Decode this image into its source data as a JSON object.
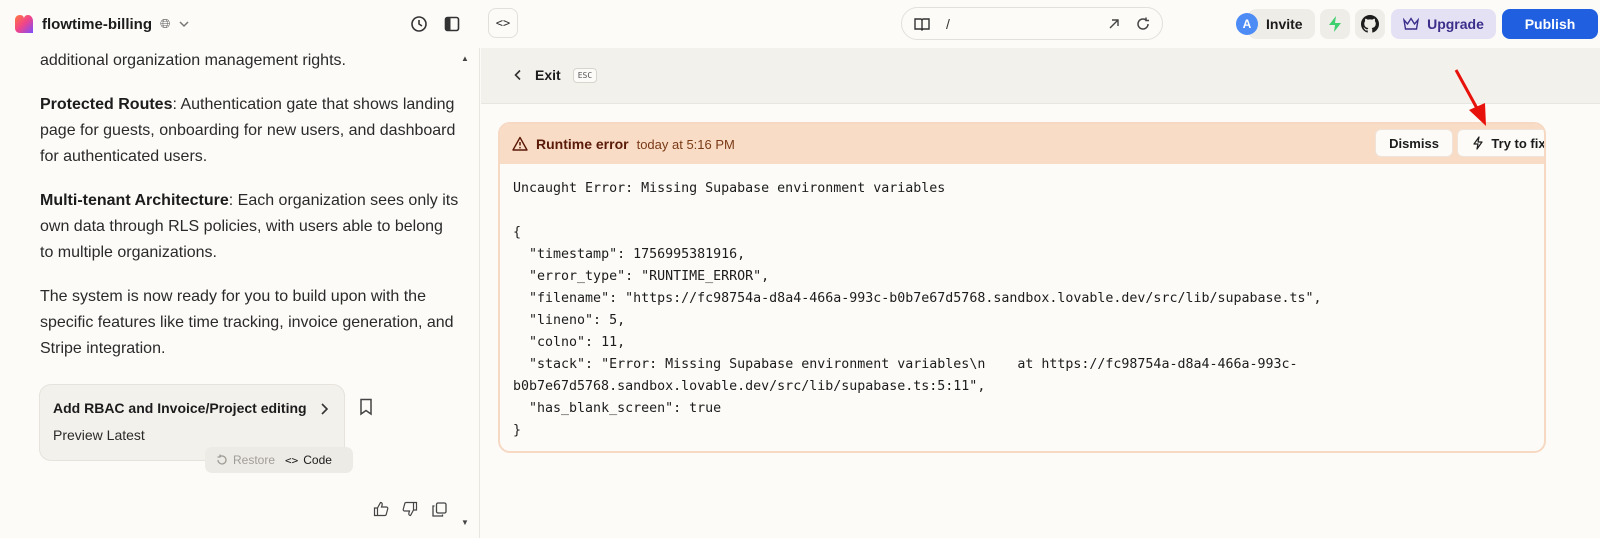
{
  "header": {
    "project_name": "flowtime-billing",
    "url_path": "/",
    "avatar_initial": "A",
    "invite_label": "Invite",
    "upgrade_label": "Upgrade",
    "publish_label": "Publish"
  },
  "chat": {
    "line_top": "additional organization management rights.",
    "sections": [
      {
        "title": "Protected Routes",
        "text": ": Authentication gate that shows landing page for guests, onboarding for new users, and dashboard for authenticated users."
      },
      {
        "title": "Multi-tenant Architecture",
        "text": ": Each organization sees only its own data through RLS policies, with users able to belong to multiple organizations."
      }
    ],
    "summary": "The system is now ready for you to build upon with the specific features like time tracking, invoice generation, and Stripe integration.",
    "card": {
      "title": "Add RBAC and Invoice/Project editing",
      "subtitle": "Preview Latest"
    },
    "restore_label": "Restore",
    "code_label": "Code"
  },
  "preview": {
    "exit_label": "Exit",
    "esc_label": "ESC",
    "error": {
      "title": "Runtime error",
      "time": "today at 5:16 PM",
      "dismiss_label": "Dismiss",
      "fix_label": "Try to fix",
      "message": "Uncaught Error: Missing Supabase environment variables\n\n{\n  \"timestamp\": 1756995381916,\n  \"error_type\": \"RUNTIME_ERROR\",\n  \"filename\": \"https://fc98754a-d8a4-466a-993c-b0b7e67d5768.sandbox.lovable.dev/src/lib/supabase.ts\",\n  \"lineno\": 5,\n  \"colno\": 11,\n  \"stack\": \"Error: Missing Supabase environment variables\\n    at https://fc98754a-d8a4-466a-993c-\nb0b7e67d5768.sandbox.lovable.dev/src/lib/supabase.ts:5:11\",\n  \"has_blank_screen\": true\n}"
    }
  },
  "colors": {
    "publish": "#1f5fe0",
    "upgrade_bg": "#e4e1f5",
    "error_header_bg": "#f9dcc6",
    "annotation_arrow": "#e8120c"
  },
  "icons": [
    "lovable-logo-icon",
    "globe-icon",
    "chevron-down-icon",
    "history-icon",
    "sidebar-toggle-icon",
    "code-icon",
    "book-icon",
    "external-link-icon",
    "refresh-icon",
    "supabase-icon",
    "github-icon",
    "crown-icon",
    "warning-icon",
    "lightning-icon",
    "chevron-left-icon",
    "chevron-right-icon",
    "bookmark-icon",
    "restore-icon",
    "thumbs-up-icon",
    "thumbs-down-icon",
    "copy-icon"
  ]
}
